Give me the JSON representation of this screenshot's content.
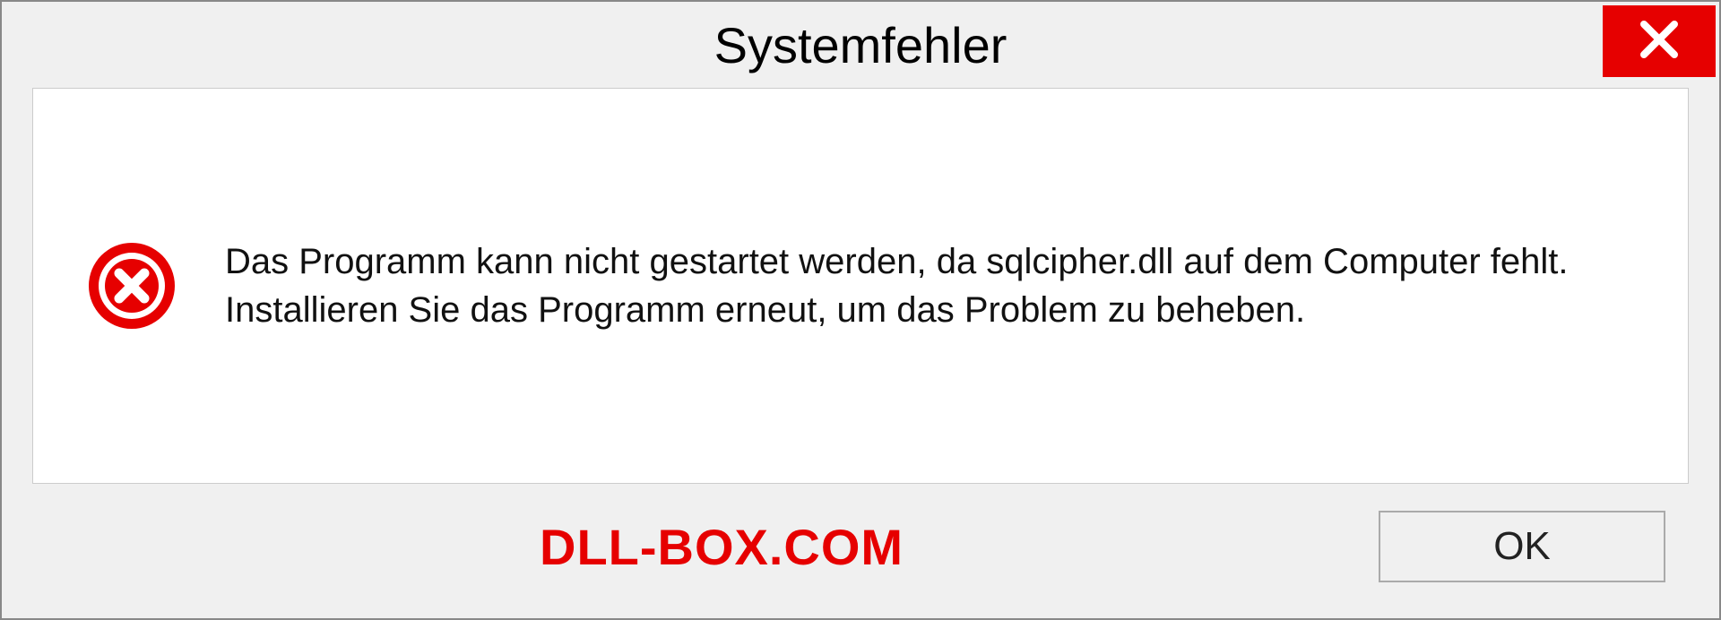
{
  "dialog": {
    "title": "Systemfehler",
    "message": "Das Programm kann nicht gestartet werden, da sqlcipher.dll auf dem Computer fehlt. Installieren Sie das Programm erneut, um das Problem zu beheben.",
    "ok_label": "OK"
  },
  "watermark": "DLL-BOX.COM",
  "icons": {
    "close": "close-icon",
    "error": "error-icon"
  },
  "colors": {
    "accent_red": "#e60000",
    "background": "#f0f0f0",
    "panel": "#ffffff"
  }
}
